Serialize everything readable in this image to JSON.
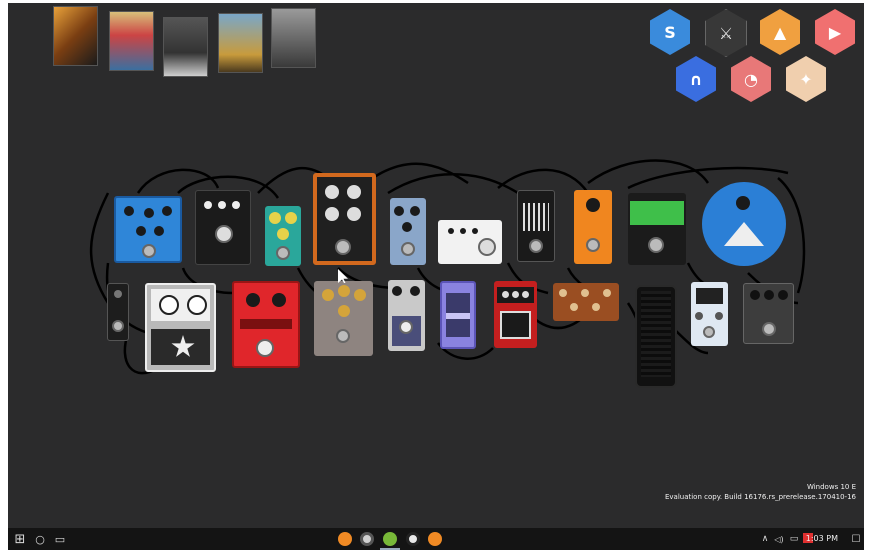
{
  "desktop": {
    "game_tiles": [
      {
        "name": "game-tile-1",
        "colors": [
          "#e8a13a",
          "#1b1b1b"
        ]
      },
      {
        "name": "game-tile-grand-theft-auto",
        "colors": [
          "#d8c07a",
          "#3b6fa0"
        ]
      },
      {
        "name": "game-tile-arma",
        "colors": [
          "#333333",
          "#cfcfcf"
        ]
      },
      {
        "name": "game-tile-ark",
        "colors": [
          "#7aa7c8",
          "#c89b3c"
        ]
      },
      {
        "name": "game-tile-dishonored",
        "colors": [
          "#3a3a3a",
          "#9a9a9a"
        ]
      }
    ],
    "app_tiles": [
      {
        "icon": "skype-icon",
        "color": "#3a8bdc",
        "glyph": "S"
      },
      {
        "icon": "skyrim-icon",
        "color": "#2b2b2c",
        "glyph": "⚔"
      },
      {
        "icon": "vlc-icon",
        "color": "#f0a040",
        "glyph": "▲"
      },
      {
        "icon": "youtube-icon",
        "color": "#f07070",
        "glyph": "▶"
      },
      {
        "icon": "app-icon",
        "color": "#3a6ee0",
        "glyph": "∩"
      },
      {
        "icon": "app-icon-red",
        "color": "#e87878",
        "glyph": "◔"
      },
      {
        "icon": "app-icon-beige",
        "color": "#f0cfae",
        "glyph": "✦"
      }
    ]
  },
  "pedals": [
    {
      "name": "pedal-blue",
      "color": "#2f86d8"
    },
    {
      "name": "pedal-black",
      "color": "#1b1b1b"
    },
    {
      "name": "pedal-teal",
      "color": "#2aa79b"
    },
    {
      "name": "pedal-orange-frame",
      "color": "#d2691e"
    },
    {
      "name": "pedal-steel-blue",
      "color": "#8aa6c9"
    },
    {
      "name": "pedal-white",
      "color": "#f2f2f2"
    },
    {
      "name": "pedal-eq",
      "color": "#1a1a1a"
    },
    {
      "name": "pedal-orange",
      "color": "#f0861f"
    },
    {
      "name": "pedal-green",
      "color": "#3fbf4a"
    },
    {
      "name": "pedal-round-blue",
      "color": "#2b7fd6"
    },
    {
      "name": "pedal-mini-black",
      "color": "#1d1d1d"
    },
    {
      "name": "pedal-grey-big",
      "color": "#b9b9b9"
    },
    {
      "name": "pedal-red",
      "color": "#e0262b"
    },
    {
      "name": "pedal-taupe",
      "color": "#8e8480"
    },
    {
      "name": "pedal-silver",
      "color": "#c9c9c9"
    },
    {
      "name": "pedal-purple",
      "color": "#8a83e0"
    },
    {
      "name": "pedal-red-black",
      "color": "#c41f1f"
    },
    {
      "name": "pedal-brown",
      "color": "#9a4e22"
    },
    {
      "name": "pedal-wah",
      "color": "#111111"
    },
    {
      "name": "pedal-mini-white",
      "color": "#dfe8f2"
    },
    {
      "name": "pedal-dark-grey",
      "color": "#3d3d3d"
    }
  ],
  "watermark": {
    "line1": "Windows 10 E",
    "line2": "Evaluation copy. Build 16176.rs_prerelease.170410-16"
  },
  "taskbar": {
    "start_glyph": "⊞",
    "search_glyph": "○",
    "task_view_glyph": "▭",
    "apps": [
      {
        "name": "taskbar-firefox",
        "color": "#f08a24"
      },
      {
        "name": "taskbar-chrome",
        "color": "#d0d0d0"
      },
      {
        "name": "taskbar-app-green",
        "color": "#78b838"
      },
      {
        "name": "taskbar-app-white",
        "color": "#e8e8e8"
      },
      {
        "name": "taskbar-firefox-2",
        "color": "#f08a24"
      }
    ],
    "tray_up": "∧",
    "tray_volume": "◁)",
    "tray_network": "▭",
    "time": "1:03 PM",
    "notifications_glyph": "☐"
  }
}
